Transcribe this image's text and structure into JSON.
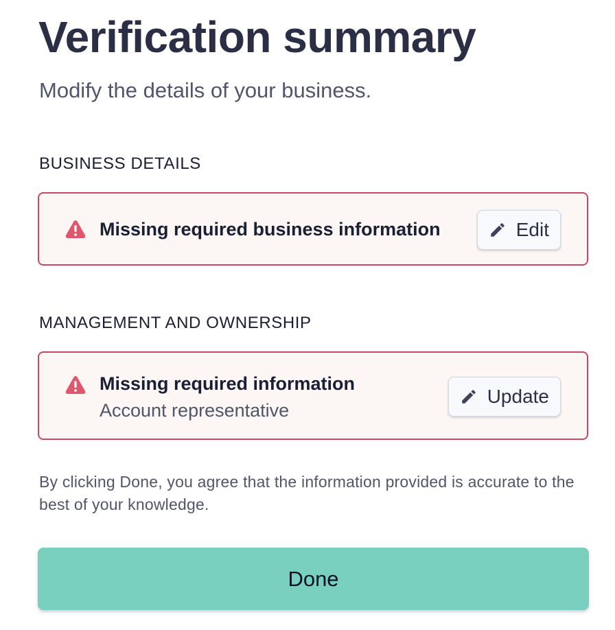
{
  "header": {
    "title": "Verification summary",
    "subtitle": "Modify the details of your business."
  },
  "sections": [
    {
      "heading": "BUSINESS DETAILS",
      "card": {
        "icon": "warning-triangle-icon",
        "title": "Missing required business information",
        "action_icon": "pencil-icon",
        "action_label": "Edit"
      }
    },
    {
      "heading": "MANAGEMENT AND OWNERSHIP",
      "card": {
        "icon": "warning-triangle-icon",
        "title": "Missing required information",
        "subtitle": "Account representative",
        "action_icon": "pencil-icon",
        "action_label": "Update"
      }
    }
  ],
  "disclaimer": "By clicking Done, you agree that the information provided is accurate to the best of your knowledge.",
  "footer": {
    "done_label": "Done"
  },
  "colors": {
    "error_border": "#cd4566",
    "error_background": "#fcf7f4",
    "warning_icon": "#e0566c",
    "primary_button": "#79d0bf",
    "text_primary": "#2a2f45"
  }
}
